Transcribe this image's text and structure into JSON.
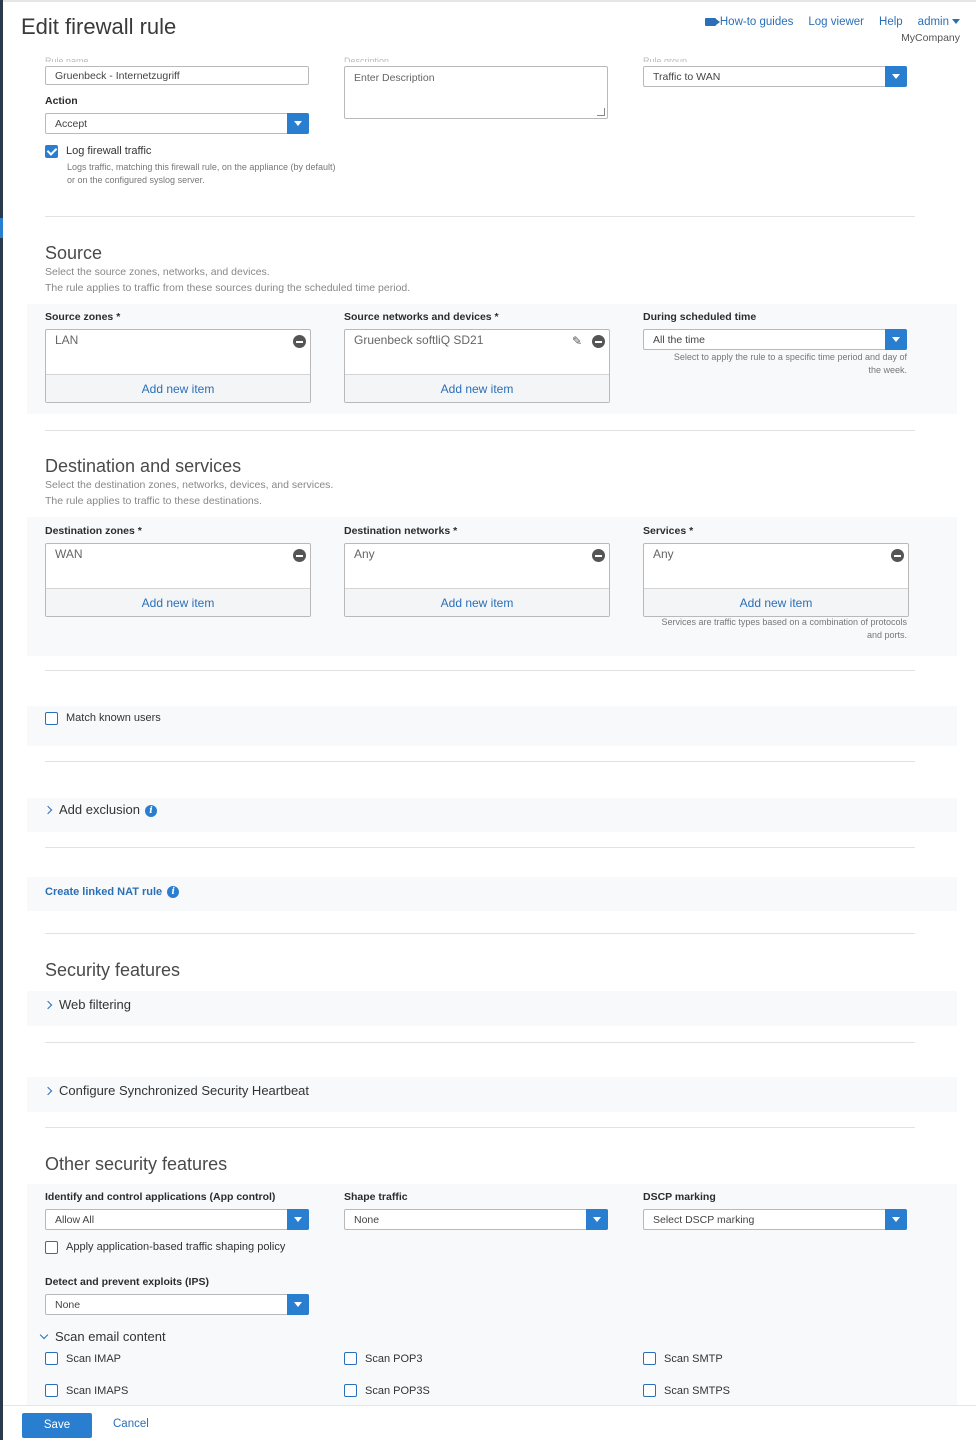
{
  "header": {
    "title": "Edit firewall rule",
    "links": {
      "how_to": "How-to guides",
      "log_viewer": "Log viewer",
      "help": "Help",
      "admin": "admin"
    },
    "company": "MyCompany"
  },
  "general": {
    "rule_name_value": "Gruenbeck - Internetzugriff",
    "description_placeholder": "Enter Description",
    "rule_group_value": "Traffic to WAN",
    "action_label": "Action",
    "action_value": "Accept",
    "log_label": "Log firewall traffic",
    "log_help": "Logs traffic, matching this firewall rule, on the appliance (by default) or on the configured syslog server."
  },
  "source": {
    "title": "Source",
    "sub1": "Select the source zones, networks, and devices.",
    "sub2": "The rule applies to traffic from these sources during the scheduled time period.",
    "zones_label": "Source zones *",
    "zones_item": "LAN",
    "networks_label": "Source networks and devices *",
    "networks_item": "Gruenbeck softliQ SD21",
    "schedule_label": "During scheduled time",
    "schedule_value": "All the time",
    "schedule_help": "Select to apply the rule to a specific time period and day of the week.",
    "add_item": "Add new item"
  },
  "destination": {
    "title": "Destination and services",
    "sub1": "Select the destination zones, networks, devices, and services.",
    "sub2": "The rule applies to traffic to these destinations.",
    "zones_label": "Destination zones *",
    "zones_item": "WAN",
    "networks_label": "Destination networks *",
    "networks_item": "Any",
    "services_label": "Services *",
    "services_item": "Any",
    "services_help": "Services are traffic types based on a combination of protocols and ports.",
    "add_item": "Add new item"
  },
  "users": {
    "match_known_users": "Match known users"
  },
  "exclusion": {
    "label": "Add exclusion"
  },
  "nat": {
    "label": "Create linked NAT rule"
  },
  "security": {
    "title": "Security features",
    "web_filtering": "Web filtering",
    "heartbeat": "Configure Synchronized Security Heartbeat"
  },
  "other": {
    "title": "Other security features",
    "app_control_label": "Identify and control applications (App control)",
    "app_control_value": "Allow All",
    "shape_label": "Shape traffic",
    "shape_value": "None",
    "dscp_label": "DSCP marking",
    "dscp_value": "Select DSCP marking",
    "app_shaping": "Apply application-based traffic shaping policy",
    "ips_label": "Detect and prevent exploits (IPS)",
    "ips_value": "None",
    "scan_email": "Scan email content",
    "scan_imap": "Scan IMAP",
    "scan_pop3": "Scan POP3",
    "scan_smtp": "Scan SMTP",
    "scan_imaps": "Scan IMAPS",
    "scan_pop3s": "Scan POP3S",
    "scan_smtps": "Scan SMTPS"
  },
  "footer": {
    "save": "Save",
    "cancel": "Cancel"
  }
}
